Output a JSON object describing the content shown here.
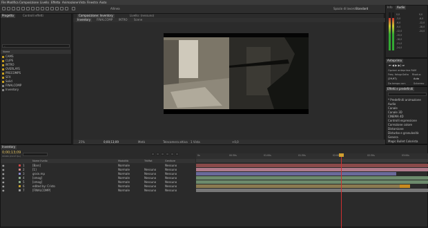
{
  "menu": [
    "File",
    "Modifica",
    "Composizione",
    "Livello",
    "Effetto",
    "Animazione",
    "Vista",
    "Finestra",
    "Aiuto"
  ],
  "toolbar": {
    "align_label": "Allinea",
    "workspace_label": "Spazio di lavoro:",
    "workspace_value": "Standard",
    "search_placeholder": "Cerca nella Guida"
  },
  "project": {
    "tab": "Progetto",
    "tab2": "Controlli effetti",
    "search_placeholder": "",
    "col_name": "Nome",
    "items": [
      "CAMS",
      "CLIPS",
      "INTRO",
      "OVERLAYS",
      "PRECOMPS",
      "SFX",
      "Solid",
      "FINALCOMP",
      "Inventory"
    ]
  },
  "viewer": {
    "tab_comp": "Composizione: Inventory",
    "tab_layer": "Livello: (nessuno)",
    "crumbs": [
      "Inventory",
      "FINALCOMP",
      "INTRO",
      "Scene"
    ],
    "zoom": "25%",
    "timecode": "0;00;13;09",
    "quality": "Metà",
    "camera": "Telecamera attiva",
    "views": "1 Vista",
    "offset": "+0,0"
  },
  "info": {
    "tab": "Info",
    "tab2": "Audio",
    "values": [
      "0,0",
      "-3,0",
      "-6,0",
      "-9,0",
      "-12,0",
      "-15,0",
      "-18,0",
      "-21,0",
      "-24,0"
    ]
  },
  "preview": {
    "tab": "Anteprima",
    "label1": "Opzioni anteprima RAM",
    "fps_label": "Freq. fotogr.",
    "skip_label": "Salta",
    "res_label": "Risoluz.",
    "fps_value": "(29,97)",
    "res_value": "Auto",
    "from_label": "Da tempo corr.",
    "full_label": "Schermo"
  },
  "effects": {
    "tab": "Effetti e predefiniti",
    "search_placeholder": "",
    "list": [
      "* Predefiniti animazione",
      "Audio",
      "Canale",
      "Canale 3D",
      "CINEMA 4D",
      "Controlli espressione",
      "Correzione colore",
      "Distorsione",
      "Disturbo e granulosità",
      "Genera",
      "Magic Bullet Colorista"
    ]
  },
  "timeline": {
    "tab": "Inventory",
    "timecode": "0;00;13;09",
    "fps": "00409 (29.97 fps)",
    "headers": {
      "layer": "Nome livello",
      "mode": "Modalità",
      "track": "TrkMat",
      "parent": "Genitore"
    },
    "layers": [
      {
        "num": "1",
        "name": "[Bars]",
        "mode": "Normale",
        "track": "",
        "parent": "Nessuno"
      },
      {
        "num": "2",
        "name": "[1]",
        "mode": "Normale",
        "track": "Nessuno",
        "parent": "Nessuno"
      },
      {
        "num": "3",
        "name": "grain.mp",
        "mode": "Normale",
        "track": "Nessuno",
        "parent": "Nessuno"
      },
      {
        "num": "4",
        "name": "[smog]",
        "mode": "Normale",
        "track": "Nessuno",
        "parent": "Nessuno"
      },
      {
        "num": "5",
        "name": "[smog]",
        "mode": "Normale",
        "track": "Nessuno",
        "parent": "Nessuno"
      },
      {
        "num": "6",
        "name": "edited by: Cristo",
        "mode": "Normale",
        "track": "Nessuno",
        "parent": "Nessuno"
      },
      {
        "num": "7",
        "name": "[FINALCOMP]",
        "mode": "Normale",
        "track": "Nessuno",
        "parent": "Nessuno"
      }
    ],
    "ruler": [
      "0s",
      "00:30s",
      "01:00s",
      "01:30s",
      "02:00s",
      "02:30s",
      "03:00s"
    ]
  }
}
